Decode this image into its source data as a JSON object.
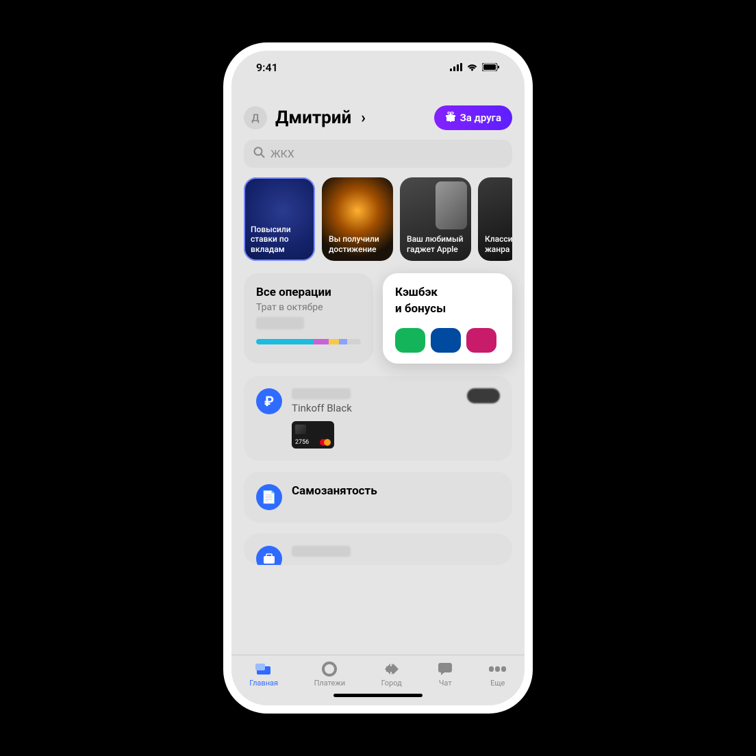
{
  "status": {
    "time": "9:41"
  },
  "header": {
    "avatar_initial": "Д",
    "user_name": "Дмитрий",
    "promo_label": "За друга"
  },
  "search": {
    "placeholder": "ЖКХ"
  },
  "stories": [
    {
      "text": "Повысили ставки по вкладам"
    },
    {
      "text": "Вы получили достижение"
    },
    {
      "text": "Ваш любимый гаджет Apple"
    },
    {
      "text": "Классика жанра"
    }
  ],
  "widgets": {
    "operations": {
      "title": "Все операции",
      "subtitle": "Трат в октябре"
    },
    "cashback": {
      "title_line1": "Кэшбэк",
      "title_line2": "и бонусы"
    }
  },
  "account": {
    "name": "Tinkoff Black",
    "card_last4": "2756"
  },
  "self_employment": {
    "label": "Самозанятость"
  },
  "tabs": {
    "home": "Главная",
    "payments": "Платежи",
    "city": "Город",
    "chat": "Чат",
    "more": "Еще"
  }
}
